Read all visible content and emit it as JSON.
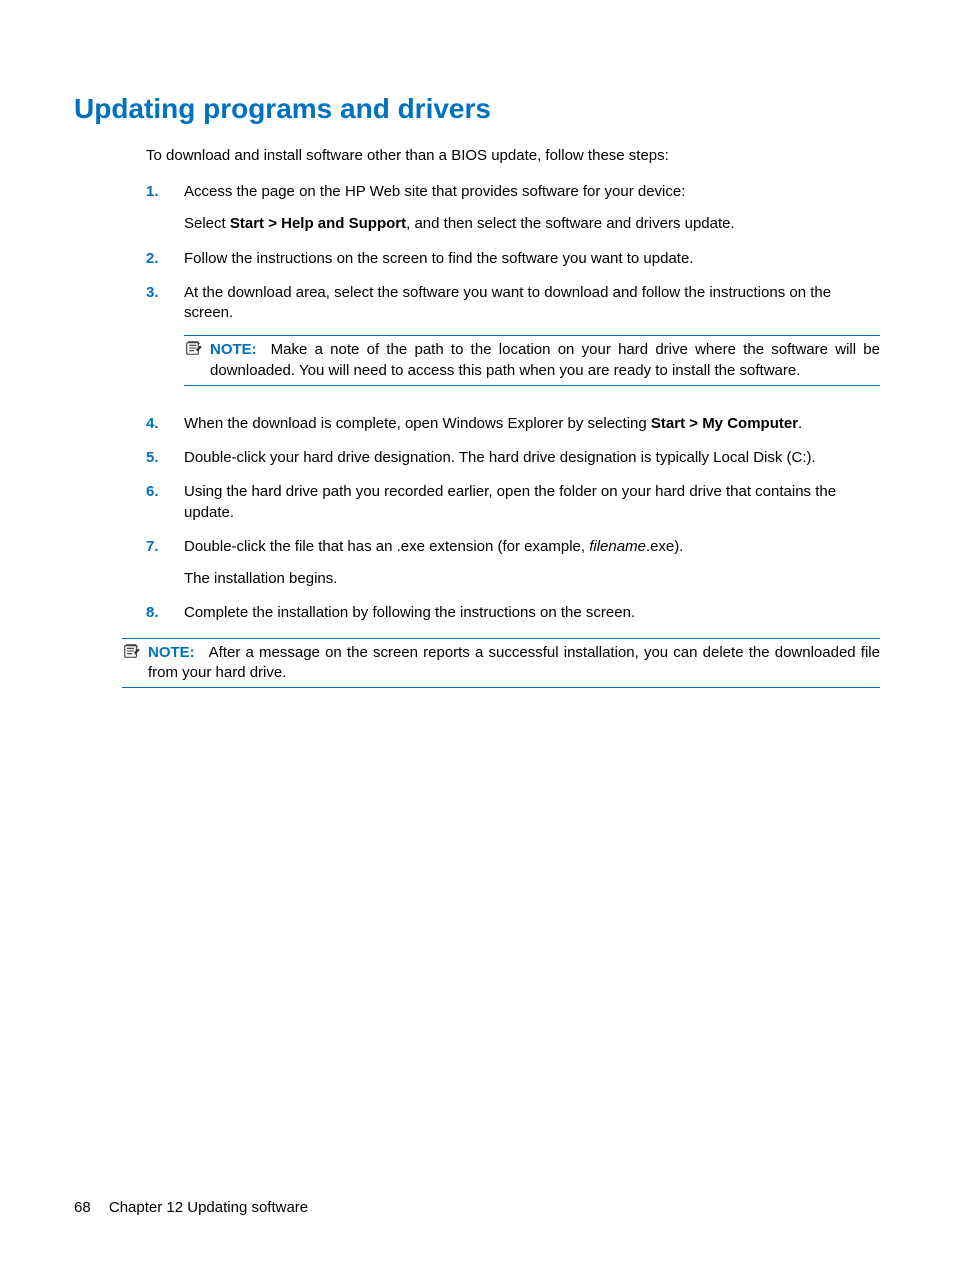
{
  "heading": "Updating programs and drivers",
  "intro": "To download and install software other than a BIOS update, follow these steps:",
  "steps": [
    {
      "num": "1.",
      "para1": "Access the page on the HP Web site that provides software for your device:",
      "para2_pre": "Select ",
      "para2_bold": "Start > Help and Support",
      "para2_post": ", and then select the software and drivers update."
    },
    {
      "num": "2.",
      "para1": "Follow the instructions on the screen to find the software you want to update."
    },
    {
      "num": "3.",
      "para1": "At the download area, select the software you want to download and follow the instructions on the screen.",
      "note_label": "NOTE:",
      "note_text": "Make a note of the path to the location on your hard drive where the software will be downloaded. You will need to access this path when you are ready to install the software."
    },
    {
      "num": "4.",
      "para1_pre": "When the download is complete, open Windows Explorer by selecting ",
      "para1_bold": "Start > My Computer",
      "para1_post": "."
    },
    {
      "num": "5.",
      "para1": "Double-click your hard drive designation. The hard drive designation is typically Local Disk (C:)."
    },
    {
      "num": "6.",
      "para1": "Using the hard drive path you recorded earlier, open the folder on your hard drive that contains the update."
    },
    {
      "num": "7.",
      "para1_pre": "Double-click the file that has an .exe extension (for example, ",
      "para1_italic": "filename",
      "para1_post": ".exe).",
      "para2": "The installation begins."
    },
    {
      "num": "8.",
      "para1": "Complete the installation by following the instructions on the screen."
    }
  ],
  "outer_note": {
    "label": "NOTE:",
    "text": "After a message on the screen reports a successful installation, you can delete the downloaded file from your hard drive."
  },
  "footer": {
    "page": "68",
    "chapter": "Chapter 12   Updating software"
  }
}
